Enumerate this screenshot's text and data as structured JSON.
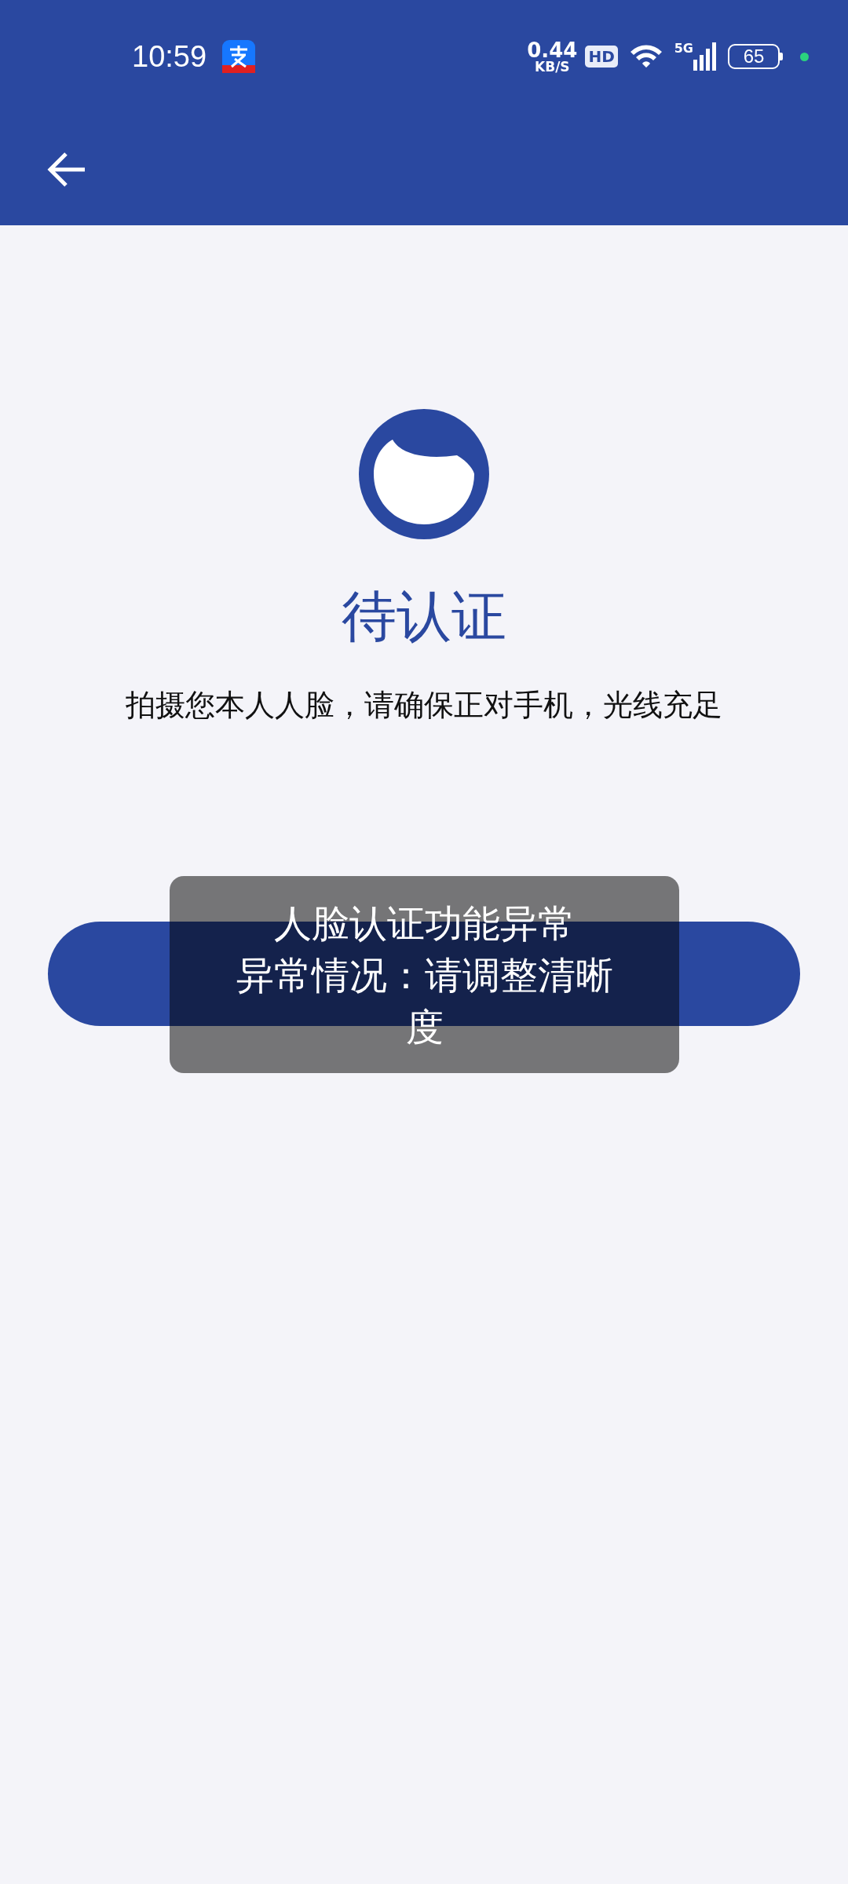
{
  "status_bar": {
    "time": "10:59",
    "speed": "0.44",
    "speed_unit": "KB/S",
    "hd": "HD",
    "network": "5G",
    "battery": "65"
  },
  "status": {
    "title": "待认证",
    "hint": "拍摄您本人人脸，请确保正对手机，光线充足"
  },
  "toast": {
    "title": "人脸认证功能异常",
    "message": "异常情况：请调整清晰度"
  }
}
